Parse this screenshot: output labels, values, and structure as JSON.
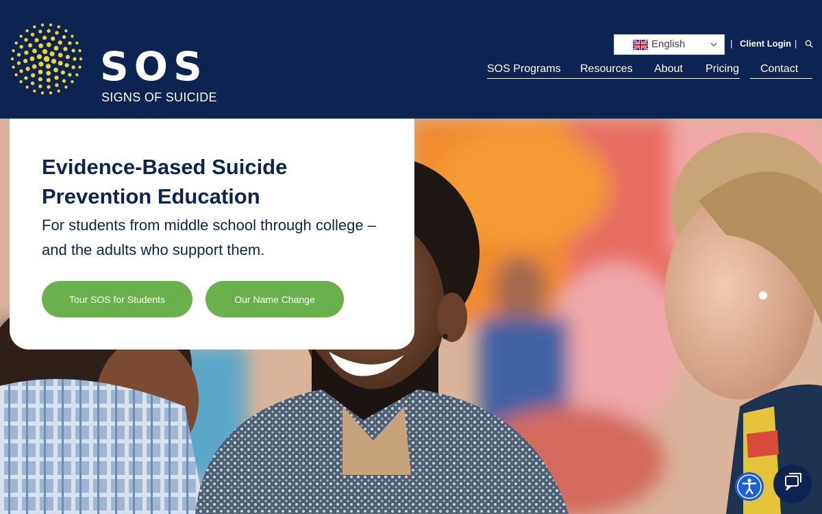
{
  "brand": {
    "name": "SOS",
    "tagline": "SIGNS OF SUICIDE",
    "accent": "#f4d22c",
    "navy": "#0b2452"
  },
  "utility": {
    "language": "English",
    "separator": "|",
    "client_login": "Client Login"
  },
  "nav": {
    "items": [
      "SOS Programs",
      "Resources",
      "About",
      "Pricing",
      "Contact"
    ]
  },
  "hero": {
    "title": "Evidence-Based Suicide Prevention Education",
    "subtitle": "For students from middle school through college – and the adults who support them.",
    "buttons": {
      "tour": "Tour SOS for Students",
      "name_change": "Our Name Change"
    },
    "button_color": "#6ab04c"
  },
  "widgets": {
    "accessibility": "accessibility-icon",
    "chat": "chat-icon"
  }
}
